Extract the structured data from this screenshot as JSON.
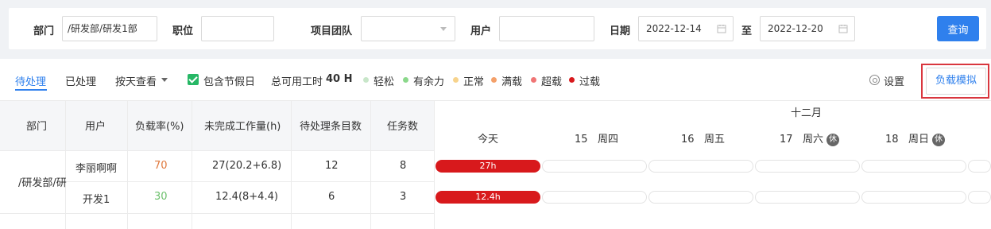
{
  "filters": {
    "dept_label": "部门",
    "dept_value": "/研发部/研发1部",
    "position_label": "职位",
    "position_value": "",
    "team_label": "项目团队",
    "team_value": "",
    "user_label": "用户",
    "user_value": "",
    "date_label": "日期",
    "date_from": "2022-12-14",
    "date_to_label": "至",
    "date_to": "2022-12-20",
    "query_label": "查询"
  },
  "toolbar": {
    "tab_pending": "待处理",
    "tab_done": "已处理",
    "view_mode": "按天查看",
    "include_holiday": "包含节假日",
    "available_hours_label": "总可用工时",
    "available_hours_value": "40 H",
    "legend": [
      {
        "label": "轻松",
        "color": "#c8e6c9"
      },
      {
        "label": "有余力",
        "color": "#8bd88b"
      },
      {
        "label": "正常",
        "color": "#f7d38c"
      },
      {
        "label": "满载",
        "color": "#f4a06a"
      },
      {
        "label": "超载",
        "color": "#f07575"
      },
      {
        "label": "过载",
        "color": "#d8191c"
      }
    ],
    "settings_label": "设置",
    "simulate_label": "负载模拟"
  },
  "table": {
    "headers": [
      "部门",
      "用户",
      "负载率(%)",
      "未完成工作量(h)",
      "待处理条目数",
      "任务数"
    ],
    "dept": "/研发部/研",
    "rows": [
      {
        "user": "李丽啊啊",
        "load": "70",
        "load_color": "#e0783c",
        "work": "27(20.2+6.8)",
        "pending": "12",
        "tasks": "8",
        "bar": "27h"
      },
      {
        "user": "开发1",
        "load": "30",
        "load_color": "#6cc06c",
        "work": "12.4(8+4.4)",
        "pending": "6",
        "tasks": "3",
        "bar": "12.4h"
      }
    ]
  },
  "calendar": {
    "month": "十二月",
    "today": "今天",
    "days": [
      {
        "num": "15",
        "weekday": "周四",
        "rest": ""
      },
      {
        "num": "16",
        "weekday": "周五",
        "rest": ""
      },
      {
        "num": "17",
        "weekday": "周六",
        "rest": "休"
      },
      {
        "num": "18",
        "weekday": "周日",
        "rest": "休"
      }
    ]
  }
}
